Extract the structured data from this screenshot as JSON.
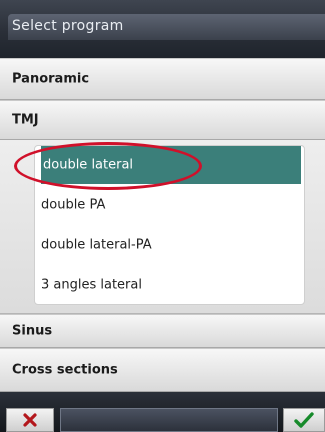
{
  "header": {
    "title": "Select program"
  },
  "categories": {
    "panoramic": "Panoramic",
    "tmj": "TMJ",
    "sinus": "Sinus",
    "cross_sections": "Cross sections"
  },
  "tmj_programs": [
    {
      "label": "double lateral",
      "selected": true
    },
    {
      "label": "double PA",
      "selected": false
    },
    {
      "label": "double lateral-PA",
      "selected": false
    },
    {
      "label": "3 angles lateral",
      "selected": false
    }
  ],
  "footer": {
    "cancel_icon": "close-icon",
    "confirm_icon": "checkmark-icon"
  },
  "colors": {
    "selected_row": "#3b7f7a",
    "highlight": "#d0102a",
    "header": "#2a2f38"
  }
}
